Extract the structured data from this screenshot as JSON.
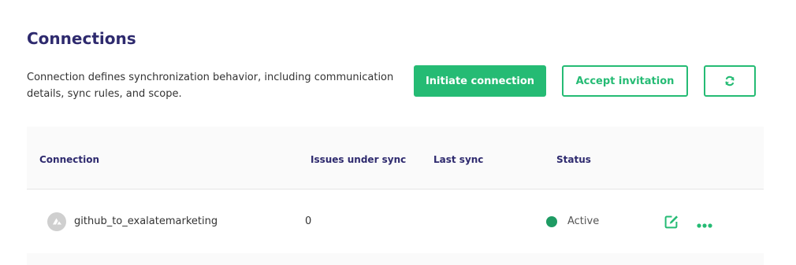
{
  "page": {
    "title": "Connections",
    "description": "Connection defines synchronization behavior, including communication details, sync rules, and scope."
  },
  "actions": {
    "initiate_label": "Initiate connection",
    "accept_label": "Accept invitation",
    "refresh_icon": "refresh-icon"
  },
  "table": {
    "headers": {
      "connection": "Connection",
      "issues": "Issues under sync",
      "last_sync": "Last sync",
      "status": "Status"
    },
    "rows": [
      {
        "avatar_icon": "connection-avatar-icon",
        "name": "github_to_exalatemarketing",
        "issues": "0",
        "last_sync": "",
        "status": "Active",
        "status_color": "#1e9b63"
      }
    ]
  },
  "colors": {
    "brand_green": "#25bb74",
    "title_navy": "#2e2a6e",
    "active_status": "#1e9b63"
  }
}
